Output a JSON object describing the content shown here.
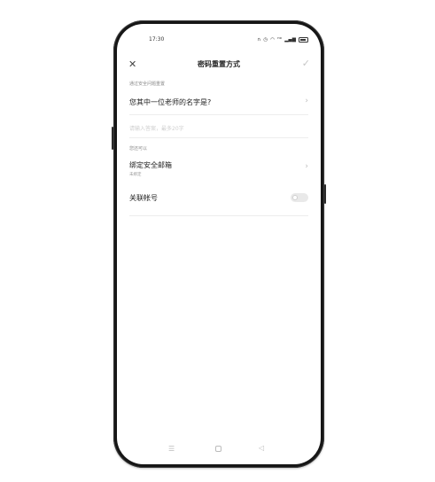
{
  "status": {
    "time": "17:30",
    "icons": [
      "headset-icon",
      "alarm-icon",
      "wifi-icon",
      "hd-icon",
      "signal-icon"
    ]
  },
  "header": {
    "title": "密码重置方式",
    "close": "✕",
    "confirm": "✓"
  },
  "security_question": {
    "section_label": "通过安全问题重置",
    "question": "您其中一位老师的名字是?",
    "answer_placeholder": "请输入答案，最多20字"
  },
  "other_options": {
    "section_label": "您还可以",
    "bind_email_title": "绑定安全邮箱",
    "bind_email_status": "未绑定",
    "linked_account_title": "关联帐号",
    "linked_account_enabled": false
  },
  "navbar": {
    "menu": "☰",
    "back": "◁"
  }
}
